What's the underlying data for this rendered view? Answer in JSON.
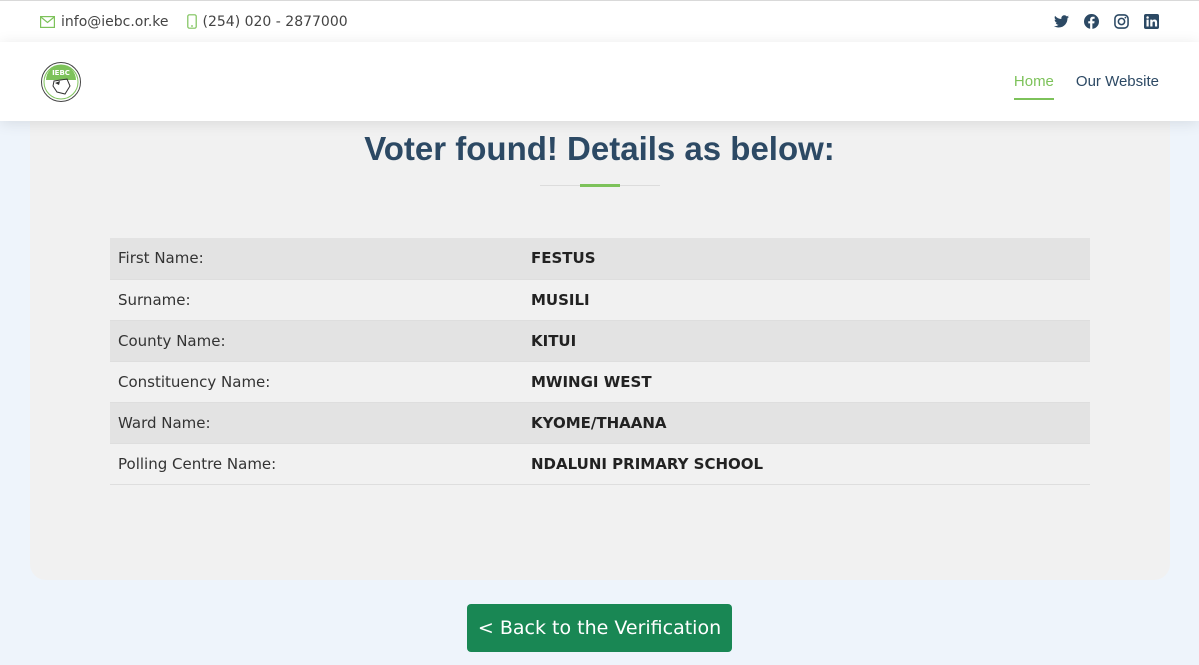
{
  "topbar": {
    "email": "info@iebc.or.ke",
    "phone": "(254) 020 - 2877000",
    "socials": [
      "twitter-icon",
      "facebook-icon",
      "instagram-icon",
      "linkedin-icon"
    ]
  },
  "header": {
    "logo_text": "IEBC",
    "nav": [
      {
        "label": "Home",
        "active": true
      },
      {
        "label": "Our Website",
        "active": false
      }
    ]
  },
  "main": {
    "title": "Voter found! Details as below:",
    "rows": [
      {
        "label": "First Name:",
        "value": "FESTUS"
      },
      {
        "label": "Surname:",
        "value": "MUSILI"
      },
      {
        "label": "County Name:",
        "value": "KITUI"
      },
      {
        "label": "Constituency Name:",
        "value": "MWINGI WEST"
      },
      {
        "label": "Ward Name:",
        "value": "KYOME/THAANA"
      },
      {
        "label": "Polling Centre Name:",
        "value": "NDALUNI PRIMARY SCHOOL"
      }
    ],
    "back_button": "< Back to the Verification"
  },
  "colors": {
    "accent": "#7dc25a",
    "brand_dark": "#2c4964",
    "button": "#198754",
    "social": "#2c4964"
  }
}
